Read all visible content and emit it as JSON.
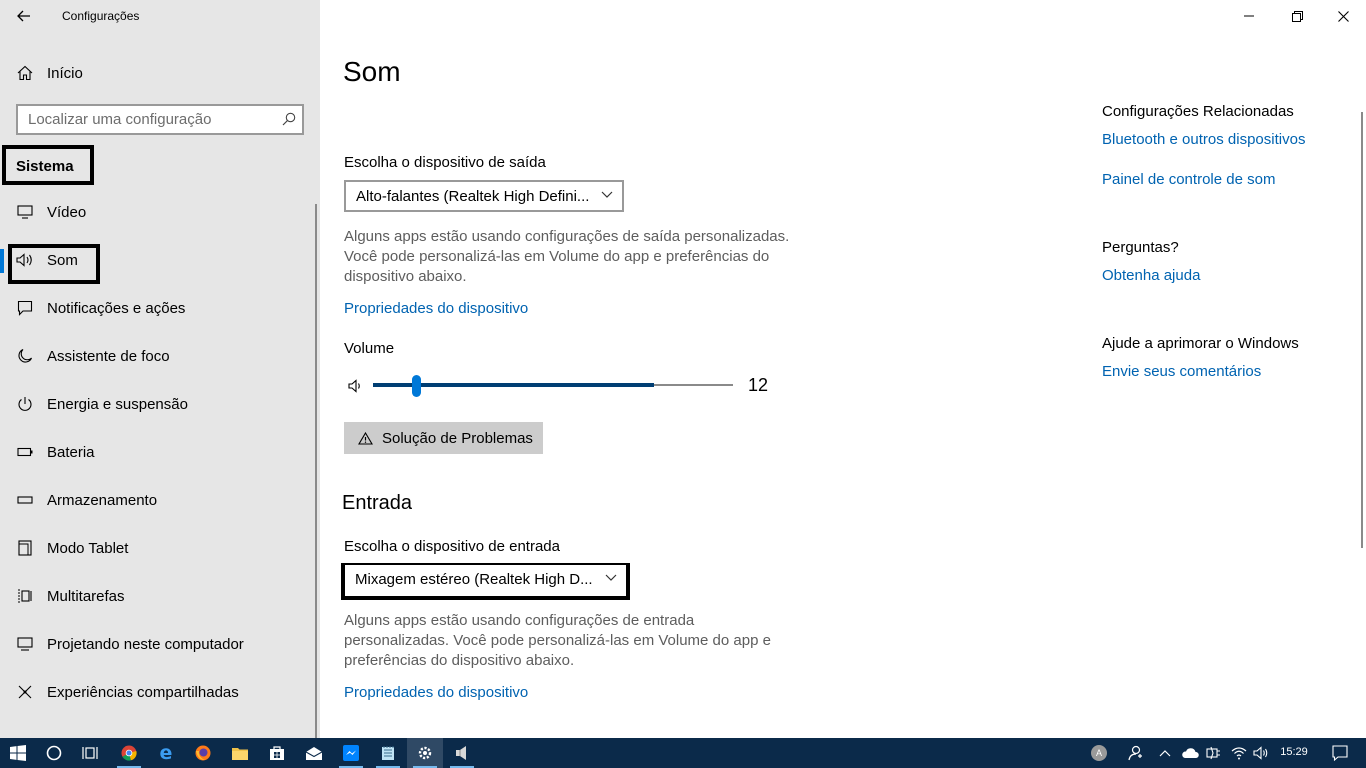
{
  "window": {
    "title": "Configurações"
  },
  "sidebar": {
    "home_label": "Início",
    "search_placeholder": "Localizar uma configuração",
    "section_title": "Sistema",
    "items": [
      {
        "label": "Vídeo",
        "icon": "monitor-icon"
      },
      {
        "label": "Som",
        "icon": "speaker-icon",
        "active": true
      },
      {
        "label": "Notificações e ações",
        "icon": "notification-icon"
      },
      {
        "label": "Assistente de foco",
        "icon": "moon-icon"
      },
      {
        "label": "Energia e suspensão",
        "icon": "power-icon"
      },
      {
        "label": "Bateria",
        "icon": "battery-icon"
      },
      {
        "label": "Armazenamento",
        "icon": "storage-icon"
      },
      {
        "label": "Modo Tablet",
        "icon": "tablet-icon"
      },
      {
        "label": "Multitarefas",
        "icon": "multitask-icon"
      },
      {
        "label": "Projetando neste computador",
        "icon": "project-icon"
      },
      {
        "label": "Experiências compartilhadas",
        "icon": "share-icon"
      }
    ]
  },
  "main": {
    "title": "Som",
    "output": {
      "label": "Escolha o dispositivo de saída",
      "selected": "Alto-falantes (Realtek High Defini...",
      "note": "Alguns apps estão usando configurações de saída personalizadas. Você pode personalizá-las em Volume do app e preferências do dispositivo abaixo.",
      "properties_link": "Propriedades do dispositivo"
    },
    "volume": {
      "label": "Volume",
      "value": "12",
      "level_fraction": 0.12,
      "fill_fraction": 0.78
    },
    "troubleshoot_label": "Solução de Problemas",
    "input": {
      "heading": "Entrada",
      "label": "Escolha o dispositivo de entrada",
      "selected": "Mixagem estéreo (Realtek High D...",
      "note": "Alguns apps estão usando configurações de entrada personalizadas. Você pode personalizá-las em Volume do app e preferências do dispositivo abaixo.",
      "properties_link": "Propriedades do dispositivo"
    }
  },
  "related": {
    "heading": "Configurações Relacionadas",
    "links": [
      "Bluetooth e outros dispositivos",
      "Painel de controle de som"
    ],
    "questions_heading": "Perguntas?",
    "help_link": "Obtenha ajuda",
    "improve_heading": "Ajude a aprimorar o Windows",
    "feedback_link": "Envie seus comentários"
  },
  "taskbar": {
    "time": "15:29",
    "tray_lang": "A",
    "apps": [
      "chrome-icon",
      "edge-icon",
      "firefox-icon",
      "file-explorer-icon",
      "store-icon",
      "mail-icon",
      "messenger-icon",
      "notepad-icon",
      "settings-icon",
      "volume-app-icon"
    ]
  },
  "colors": {
    "accent": "#0078d7",
    "link": "#0063b1",
    "sidebar_bg": "#e6e6e6",
    "taskbar_bg": "#0b2a4a"
  }
}
